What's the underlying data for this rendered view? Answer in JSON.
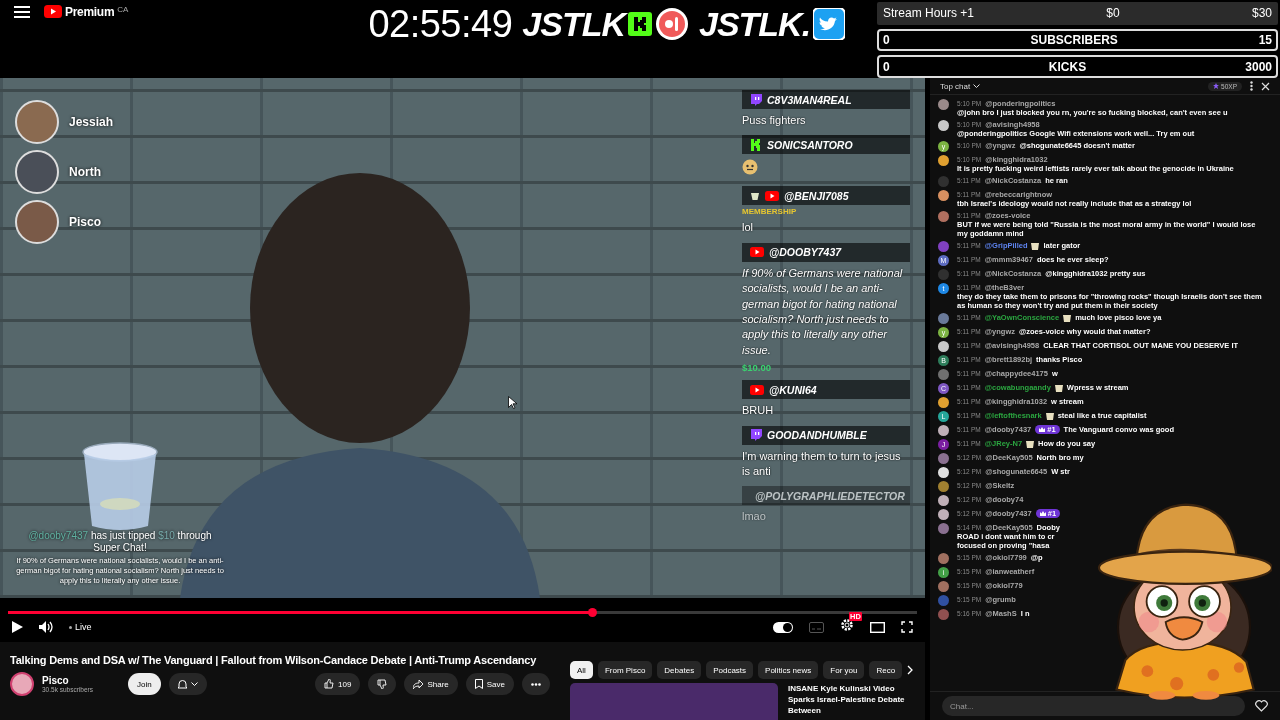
{
  "top_bar": {
    "logo_text": "Premium",
    "region": "CA",
    "timer": "02:55:49",
    "brand_logos": [
      {
        "text": "JSTLK",
        "icons": [
          {
            "kind": "kick"
          },
          {
            "kind": "live"
          }
        ]
      },
      {
        "text": "JSTLK.",
        "icons": [
          {
            "kind": "twitter"
          }
        ]
      }
    ]
  },
  "goal_widget": {
    "title": "Stream Hours +1",
    "current": "$0",
    "target": "$30",
    "bars": [
      {
        "start": "0",
        "label": "SUBSCRIBERS",
        "end": "15"
      },
      {
        "start": "0",
        "label": "KICKS",
        "end": "3000"
      }
    ]
  },
  "video": {
    "participants": [
      {
        "name": "Jessiah",
        "color": "#8a6a50"
      },
      {
        "name": "North",
        "color": "#4a4f58"
      },
      {
        "name": "Pisco",
        "color": "#7a5a48"
      }
    ],
    "overlay_chat": [
      {
        "source": {
          "kind": "twitch"
        },
        "kind": "text",
        "name": "C8V3MAN4REAL",
        "member_badge": false,
        "faded": false,
        "text": "Puss fighters"
      },
      {
        "source": {
          "kind": "kick"
        },
        "kind": "emote",
        "name": "SONICSANTORO",
        "member_badge": false,
        "faded": false
      },
      {
        "source": {
          "kind": "youtube"
        },
        "kind": "text",
        "name": "@BENJI7085",
        "member_badge": true,
        "faded": false,
        "tag": "MEMBERSHIP",
        "text": "lol"
      },
      {
        "source": {
          "kind": "youtube"
        },
        "kind": "superchat",
        "name": "@DOOBY7437",
        "member_badge": false,
        "faded": false,
        "text": "If 90% of Germans were national socialists, would I be an anti-german bigot for hating national socialism? North just needs to apply this to literally any other issue.",
        "amount": "$10.00"
      },
      {
        "source": {
          "kind": "youtube"
        },
        "kind": "text",
        "name": "@KUNI64",
        "member_badge": false,
        "faded": false,
        "text": "BRUH"
      },
      {
        "source": {
          "kind": "twitch"
        },
        "kind": "text",
        "name": "GOODANDHUMBLE",
        "member_badge": false,
        "faded": false,
        "text": "I'm warning them to turn to jesus is anti"
      },
      {
        "source": {
          "kind": "youtube"
        },
        "kind": "text",
        "name": "@POLYGRAPHLIEDETECTOR",
        "member_badge": false,
        "faded": true,
        "text": "lmao"
      }
    ],
    "alert": {
      "tipper": "@dooby7437",
      "action": "has just tipped",
      "amount": "$10",
      "suffix": "through Super Chat!",
      "body": "If 90% of Germans were national socialists, would I be an anti-german bigot for hating national socialism? North just needs to apply this to literally any other issue."
    }
  },
  "player": {
    "progress": {
      "level": 0.643
    },
    "live_label": "Live",
    "autoplay": {
      "on": true
    },
    "captions": {
      "disabled": true
    },
    "quality_badge": "HD"
  },
  "watch": {
    "title": "Talking Dems and DSA w/ The Vanguard | Fallout from Wilson-Candace Debate | Anti-Trump Ascendancy",
    "channel": {
      "name": "Pisco",
      "subscribers": "30.5k subscribers"
    },
    "join": "Join",
    "likes": "109",
    "share": "Share",
    "save": "Save"
  },
  "related": {
    "chips": [
      {
        "label": "All",
        "selected": true
      },
      {
        "label": "From Pisco",
        "selected": false
      },
      {
        "label": "Debates",
        "selected": false
      },
      {
        "label": "Podcasts",
        "selected": false
      },
      {
        "label": "Politics news",
        "selected": false
      },
      {
        "label": "For you",
        "selected": false
      },
      {
        "label": "Reco",
        "selected": false
      }
    ],
    "video": {
      "title": "INSANE Kyle Kulinski Video Sparks Israel-Palestine Debate Between"
    }
  },
  "chat": {
    "header": {
      "mode": "Top chat",
      "xp": "50XP"
    },
    "messages": [
      {
        "time": "5:10 PM",
        "author": "@ponderingpolitics",
        "kind": "viewer",
        "color": "#9a8a8a",
        "text": "@john bro I just blocked you rn, you're so fucking blocked, can't even see u"
      },
      {
        "time": "5:10 PM",
        "author": "@avisingh4958",
        "kind": "viewer",
        "color": "#c8c8c8",
        "text": "@ponderingpolitics Google Wifi extensions work well... Try em out"
      },
      {
        "time": "5:10 PM",
        "author": "@yngwz",
        "kind": "viewer",
        "color": "#7cb342",
        "letter": "y",
        "text": "@shogunate6645 doesn't matter"
      },
      {
        "time": "5:10 PM",
        "author": "@kingghidra1032",
        "kind": "viewer",
        "color": "#e0a030",
        "text": "It is pretty fucking weird leftists rarely ever talk about the genocide in Ukraine"
      },
      {
        "time": "5:11 PM",
        "author": "@NickCostanza",
        "kind": "viewer",
        "color": "#303030",
        "text": "he ran"
      },
      {
        "time": "5:11 PM",
        "author": "@rebeccarightnow",
        "kind": "viewer",
        "color": "#d89060",
        "text": "tbh Israel's ideology would not really include that as a strategy lol"
      },
      {
        "time": "5:11 PM",
        "author": "@zoes-voice",
        "kind": "viewer",
        "color": "#b07060",
        "text": "BUT if we were being told \"Russia is the most moral army in the world\" I would lose my goddamn mind"
      },
      {
        "time": "5:11 PM",
        "author": "@GripPilled",
        "kind": "moderator",
        "color": "#8040c0",
        "text": "later gator"
      },
      {
        "time": "5:11 PM",
        "author": "@mmm39467",
        "kind": "viewer",
        "color": "#5c6bc0",
        "letter": "M",
        "text": "does he ever sleep?"
      },
      {
        "time": "5:11 PM",
        "author": "@NickCostanza",
        "kind": "viewer",
        "color": "#303030",
        "text": "@kingghidra1032 pretty sus"
      },
      {
        "time": "5:11 PM",
        "author": "@theB3ver",
        "kind": "viewer",
        "color": "#1e88e5",
        "letter": "t",
        "text": "they do they take them to prisons for \"throwing rocks\" though Israelis don't see them as human so they won't try and put them in their society"
      },
      {
        "time": "5:11 PM",
        "author": "@YaOwnConscience",
        "kind": "member",
        "color": "#6a7a9a",
        "text": "much love pisco love ya"
      },
      {
        "time": "5:11 PM",
        "author": "@yngwz",
        "kind": "viewer",
        "color": "#7cb342",
        "letter": "y",
        "text": "@zoes-voice why would that matter?"
      },
      {
        "time": "5:11 PM",
        "author": "@avisingh4958",
        "kind": "viewer",
        "color": "#c8c8c8",
        "text": "CLEAR THAT CORTISOL OUT MANE YOU DESERVE IT"
      },
      {
        "time": "5:11 PM",
        "author": "@brett1892bj",
        "kind": "viewer",
        "color": "#2e7d5b",
        "letter": "B",
        "text": "thanks Pisco"
      },
      {
        "time": "5:11 PM",
        "author": "@chappydee4175",
        "kind": "viewer",
        "color": "#707070",
        "text": "w"
      },
      {
        "time": "5:11 PM",
        "author": "@cowabungaandy",
        "kind": "member",
        "color": "#7e57c2",
        "letter": "C",
        "text": "Wpress w stream"
      },
      {
        "time": "5:11 PM",
        "author": "@kingghidra1032",
        "kind": "viewer",
        "color": "#e0a030",
        "text": "w stream"
      },
      {
        "time": "5:11 PM",
        "author": "@leftofthesnark",
        "kind": "member",
        "color": "#26a69a",
        "letter": "L",
        "text": "steal like a true capitalist"
      },
      {
        "time": "5:11 PM",
        "author": "@dooby7437",
        "kind": "viewer",
        "color": "#c0b0b8",
        "rank": "#1",
        "text": "The Vanguard convo was good"
      },
      {
        "time": "5:11 PM",
        "author": "@JRey-N7",
        "kind": "member",
        "color": "#7b1fa2",
        "letter": "J",
        "text": "How do you say"
      },
      {
        "time": "5:12 PM",
        "author": "@DeeKay505",
        "kind": "viewer",
        "color": "#8a7090",
        "text": "North bro my"
      },
      {
        "time": "5:12 PM",
        "author": "@shogunate6645",
        "kind": "viewer",
        "color": "#e0e0e0",
        "text": "W str"
      },
      {
        "time": "5:12 PM",
        "author": "@Skeltz",
        "kind": "viewer",
        "color": "#a08030"
      },
      {
        "time": "5:12 PM",
        "author": "@dooby74",
        "kind": "viewer",
        "color": "#c0b0b8"
      },
      {
        "time": "5:12 PM",
        "author": "@dooby7437",
        "kind": "viewer",
        "color": "#c0b0b8",
        "rank": "#1"
      },
      {
        "time": "5:14 PM",
        "author": "@DeeKay505",
        "kind": "viewer",
        "color": "#8a7090",
        "text": "Dooby",
        "more": [
          "ROAD i dont want him to cr",
          "focused on proving \"hasa"
        ]
      },
      {
        "time": "5:15 PM",
        "author": "@okiol7799",
        "kind": "viewer",
        "color": "#a07060",
        "text": "@p"
      },
      {
        "time": "5:15 PM",
        "author": "@ianweatherf",
        "kind": "viewer",
        "color": "#43a047",
        "letter": "i"
      },
      {
        "time": "5:15 PM",
        "author": "@okiol779",
        "kind": "viewer",
        "color": "#a07060"
      },
      {
        "time": "5:15 PM",
        "author": "@grumb",
        "kind": "viewer",
        "color": "#3050a0"
      },
      {
        "time": "5:16 PM",
        "author": "@MashS",
        "kind": "viewer",
        "color": "#905050",
        "text": "I n"
      }
    ],
    "input": {
      "placeholder": "Chat..."
    }
  }
}
